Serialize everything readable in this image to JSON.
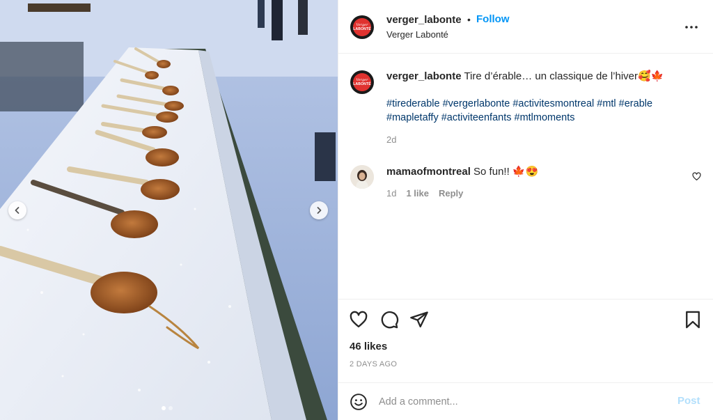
{
  "post": {
    "author": {
      "username": "verger_labonte",
      "subtitle": "Verger Labonté",
      "avatar_text_top": "Verger",
      "avatar_text_bottom": "LABONTÉ"
    },
    "follow_label": "Follow",
    "separator": "•",
    "caption": {
      "username": "verger_labonte",
      "text": "Tire d’érable… un classique de l’hiver🥰🍁",
      "hashtags_line1": "#tirederable #vergerlabonte #activitesmontreal #mtl #erable",
      "hashtags_line2": "#mapletaffy #activiteenfants #mtlmoments",
      "age": "2d"
    },
    "comments": [
      {
        "username": "mamaofmontreal",
        "text": "So fun!! 🍁😍",
        "age": "1d",
        "likes": "1 like",
        "reply_label": "Reply"
      }
    ],
    "likes": "46 likes",
    "time_ago": "2 DAYS AGO",
    "comment_placeholder": "Add a comment...",
    "post_label": "Post"
  },
  "carousel": {
    "slide_count": 2,
    "active_slide": 1
  },
  "icons": {
    "more": "more-options-icon",
    "heart": "heart-icon",
    "comment": "comment-icon",
    "share": "share-icon",
    "save": "bookmark-icon",
    "emoji": "emoji-icon",
    "prev": "chevron-left-icon",
    "next": "chevron-right-icon"
  },
  "colors": {
    "brand_red": "#e0322f",
    "link_blue": "#0095f6",
    "hashtag_blue": "#00376b",
    "muted_gray": "#8e8e8e",
    "post_disabled": "#b2dffc"
  }
}
